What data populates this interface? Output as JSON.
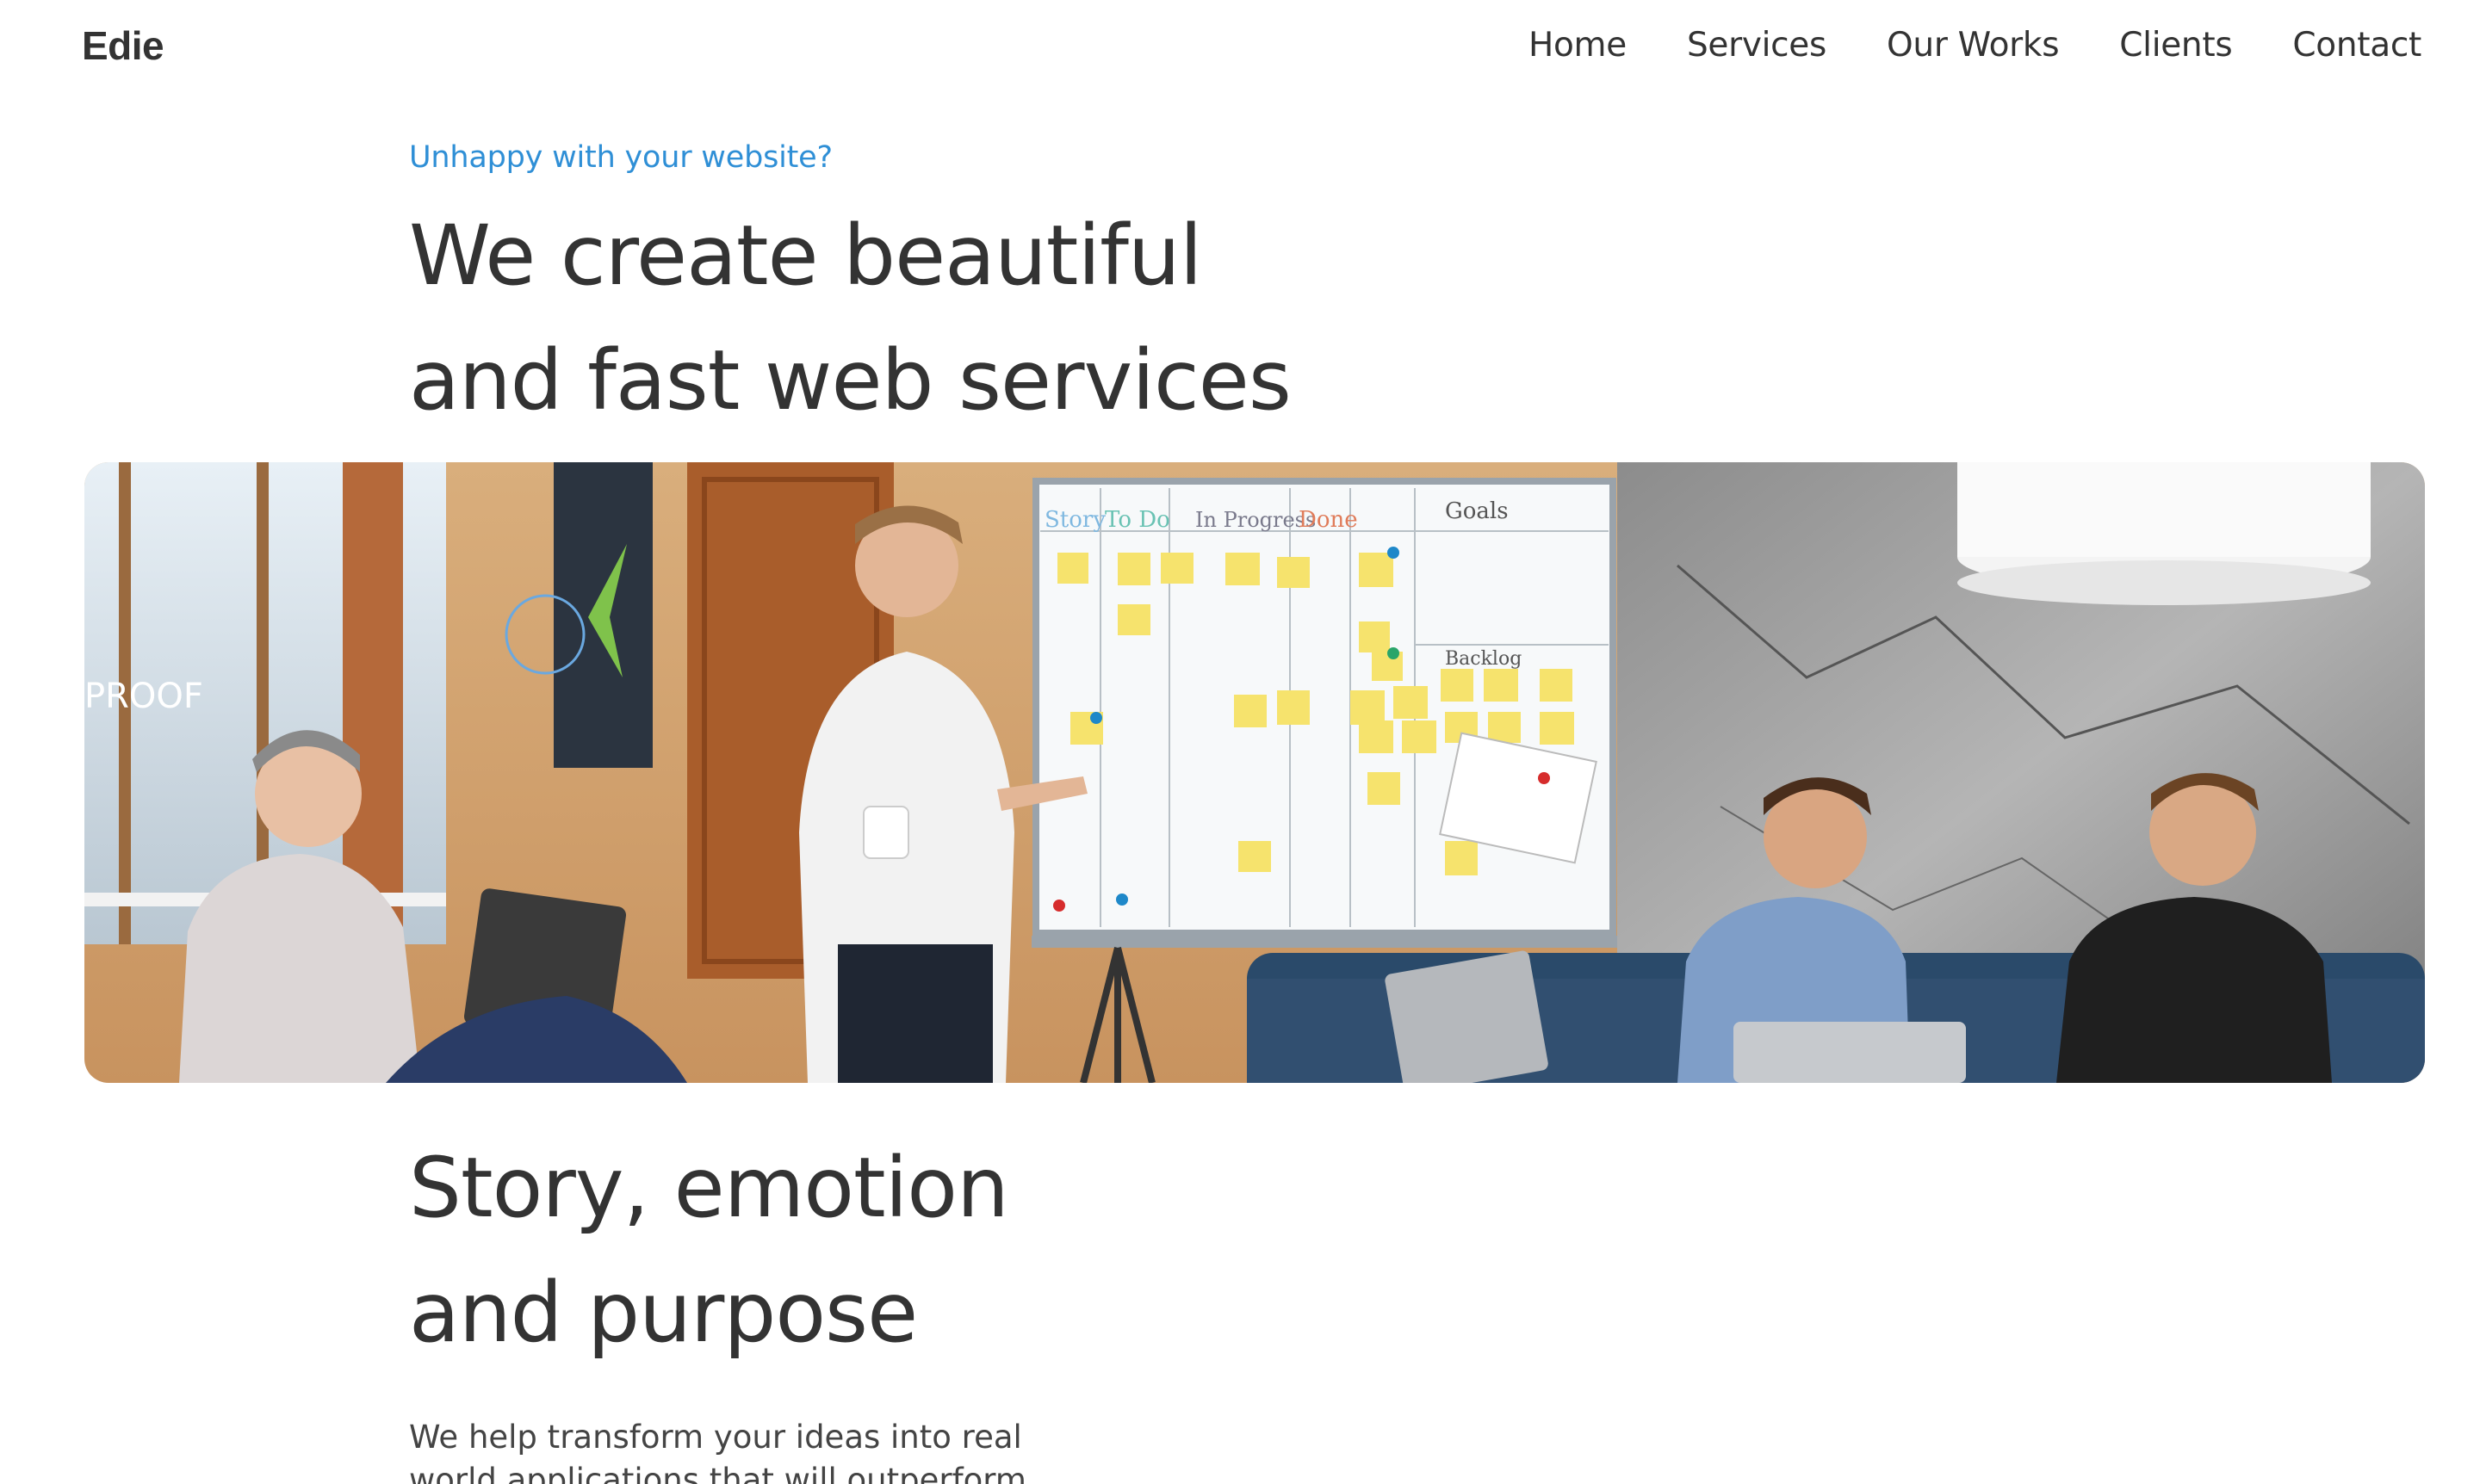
{
  "header": {
    "logo": "Edie",
    "nav": [
      {
        "label": "Home"
      },
      {
        "label": "Services"
      },
      {
        "label": "Our Works"
      },
      {
        "label": "Clients"
      },
      {
        "label": "Contact"
      }
    ]
  },
  "hero": {
    "kicker": "Unhappy with your website?",
    "title_line1": "We create beautiful",
    "title_line2": "and fast web services"
  },
  "photo": {
    "whiteboard_columns": [
      "Story",
      "To Do",
      "In Progress",
      "Done",
      "Goals"
    ],
    "whiteboard_backlog": "Backlog",
    "window_sign": "PROOF"
  },
  "section": {
    "title_line1": "Story, emotion",
    "title_line2": "and purpose",
    "body": "We help transform your ideas into real world applications that will outperform"
  },
  "colors": {
    "accent": "#2f8fd6",
    "text": "#333333",
    "background": "#ffffff"
  }
}
